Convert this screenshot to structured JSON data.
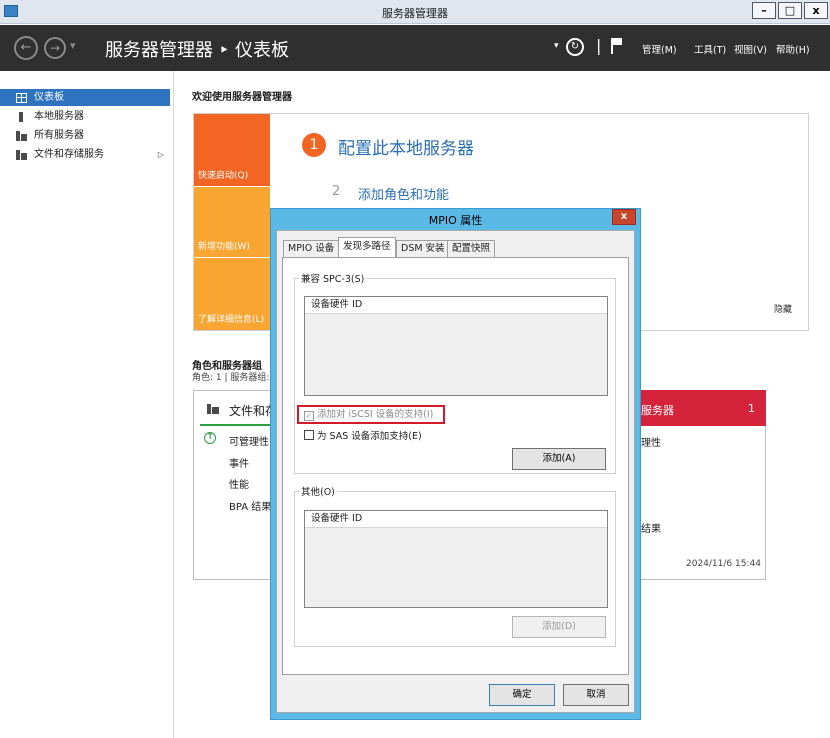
{
  "window": {
    "title": "服务器管理器"
  },
  "header": {
    "breadcrumb": "服务器管理器 ‣ 仪表板",
    "menus": [
      "管理(M)",
      "工具(T)",
      "视图(V)",
      "帮助(H)"
    ]
  },
  "sidebar": {
    "items": [
      {
        "label": "仪表板",
        "active": true
      },
      {
        "label": "本地服务器"
      },
      {
        "label": "所有服务器"
      },
      {
        "label": "文件和存储服务",
        "has_submenu": true
      }
    ]
  },
  "welcome": {
    "title": "欢迎使用服务器管理器",
    "tiles": [
      "快速启动(Q)",
      "新增功能(W)",
      "了解详细信息(L)"
    ],
    "step1": {
      "num": "1",
      "text": "配置此本地服务器"
    },
    "step2": {
      "num": "2",
      "text": "添加角色和功能"
    },
    "hide": "隐藏"
  },
  "roles": {
    "title": "角色和服务器组",
    "subtitle": "角色: 1 | 服务器组:",
    "card1": {
      "title": "文件和存",
      "rows": [
        "可管理性",
        "事件",
        "性能",
        "BPA 结果"
      ]
    },
    "card2": {
      "title": "服务器",
      "count": "1",
      "rows": [
        "理性",
        "结果"
      ],
      "timestamp": "2024/11/6 15:44"
    }
  },
  "dialog": {
    "title": "MPIO 属性",
    "close": "x",
    "tabs": [
      "MPIO 设备",
      "发现多路径",
      "DSM 安装",
      "配置快照"
    ],
    "active_tab": 1,
    "spc3": {
      "label": "兼容 SPC-3(S)",
      "list_header": "设备硬件 ID",
      "iscsi_checkbox": {
        "label": "添加对 iSCSI 设备的支持(I)",
        "checked": true,
        "disabled": true
      },
      "sas_checkbox": {
        "label": "为 SAS 设备添加支持(E)",
        "checked": false
      },
      "add_button": "添加(A)"
    },
    "other": {
      "label": "其他(O)",
      "list_header": "设备硬件 ID",
      "add_button": "添加(D)"
    },
    "ok": "确定",
    "cancel": "取消"
  }
}
